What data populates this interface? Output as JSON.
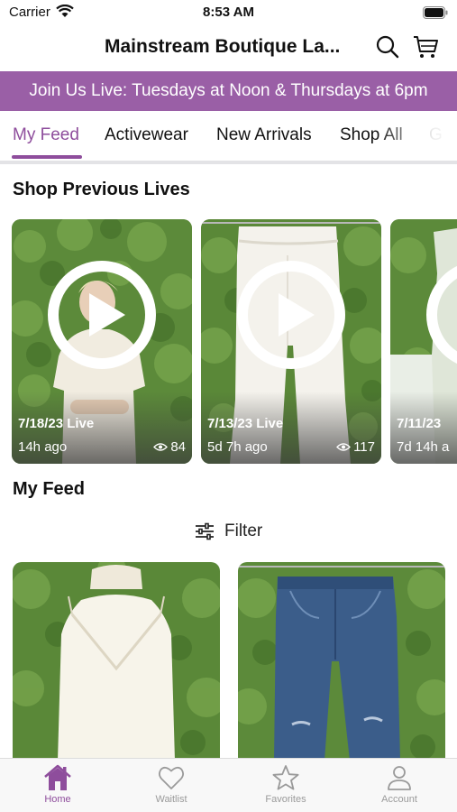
{
  "status_bar": {
    "carrier": "Carrier",
    "time": "8:53 AM"
  },
  "header": {
    "store_title": "Mainstream Boutique La...",
    "icons": [
      "search-icon",
      "cart-icon"
    ]
  },
  "banner": {
    "text": "Join Us Live: Tuesdays at Noon & Thursdays at 6pm"
  },
  "tabs": [
    {
      "label": "My Feed",
      "active": true
    },
    {
      "label": "Activewear"
    },
    {
      "label": "New Arrivals"
    },
    {
      "label": "Shop All"
    },
    {
      "label": "G"
    }
  ],
  "previous_lives": {
    "title": "Shop Previous Lives",
    "items": [
      {
        "label": "7/18/23 Live",
        "ago": "14h ago",
        "views": "84"
      },
      {
        "label": "7/13/23 Live",
        "ago": "5d 7h ago",
        "views": "117"
      },
      {
        "label": "7/11/23",
        "ago": "7d 14h a"
      }
    ]
  },
  "feed": {
    "title": "My Feed",
    "filter_label": "Filter",
    "items": [
      {
        "description": "white lace camisole"
      },
      {
        "description": "distressed denim jeans"
      }
    ]
  },
  "bottom_nav": [
    {
      "label": "Home",
      "icon": "home-icon",
      "active": true
    },
    {
      "label": "Waitlist",
      "icon": "heart-icon"
    },
    {
      "label": "Favorites",
      "icon": "star-icon"
    },
    {
      "label": "Account",
      "icon": "person-icon"
    }
  ],
  "colors": {
    "accent": "#8e4d9c",
    "banner": "#9a5fa6",
    "foliage": "#5f8a3e"
  }
}
